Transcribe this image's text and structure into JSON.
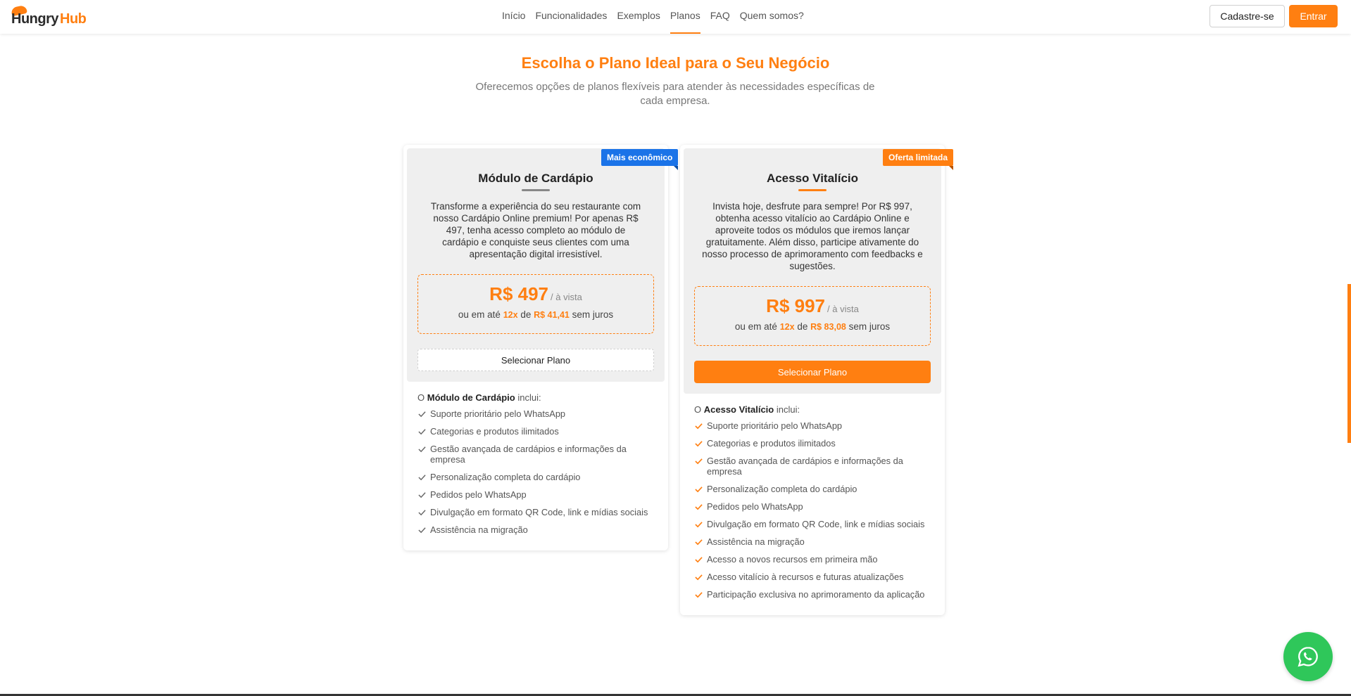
{
  "header": {
    "logo_part1": "Hungry",
    "logo_part2": "Hub",
    "nav": [
      "Início",
      "Funcionalidades",
      "Exemplos",
      "Planos",
      "FAQ",
      "Quem somos?"
    ],
    "signup_label": "Cadastre-se",
    "login_label": "Entrar"
  },
  "hero": {
    "title": "Escolha o Plano Ideal para o Seu Negócio",
    "subtitle": "Oferecemos opções de planos flexíveis para atender às necessidades específicas de cada empresa."
  },
  "plans": [
    {
      "badge": "Mais econômico",
      "name": "Módulo de Cardápio",
      "description": "Transforme a experiência do seu restaurante com nosso Cardápio Online premium! Por apenas R$ 497, tenha acesso completo ao módulo de cardápio e conquiste seus clientes com uma apresentação digital irresistível.",
      "price": "R$ 497",
      "price_suffix": "/ à vista",
      "install_prefix": "ou em até",
      "install_count": "12x",
      "install_mid": "de",
      "install_value": "R$ 41,41",
      "install_suffix": "sem juros",
      "button": "Selecionar Plano",
      "includes_prefix": "O",
      "includes_name": "Módulo de Cardápio",
      "includes_suffix": "inclui:",
      "features": [
        "Suporte prioritário pelo WhatsApp",
        "Categorias e produtos ilimitados",
        "Gestão avançada de cardápios e informações da empresa",
        "Personalização completa do cardápio",
        "Pedidos pelo WhatsApp",
        "Divulgação em formato QR Code, link e mídias sociais",
        "Assistência na migração"
      ]
    },
    {
      "badge": "Oferta limitada",
      "name": "Acesso Vitalício",
      "description": "Invista hoje, desfrute para sempre! Por R$ 997, obtenha acesso vitalício ao Cardápio Online e aproveite todos os módulos que iremos lançar gratuitamente. Além disso, participe ativamente do nosso processo de aprimoramento com feedbacks e sugestões.",
      "price": "R$ 997",
      "price_suffix": "/ à vista",
      "install_prefix": "ou em até",
      "install_count": "12x",
      "install_mid": "de",
      "install_value": "R$ 83,08",
      "install_suffix": "sem juros",
      "button": "Selecionar Plano",
      "includes_prefix": "O",
      "includes_name": "Acesso Vitalício",
      "includes_suffix": "inclui:",
      "features": [
        "Suporte prioritário pelo WhatsApp",
        "Categorias e produtos ilimitados",
        "Gestão avançada de cardápios e informações da empresa",
        "Personalização completa do cardápio",
        "Pedidos pelo WhatsApp",
        "Divulgação em formato QR Code, link e mídias sociais",
        "Assistência na migração",
        "Acesso a novos recursos em primeira mão",
        "Acesso vitalício à recursos e futuras atualizações",
        "Participação exclusiva no aprimoramento da aplicação"
      ]
    }
  ],
  "colors": {
    "accent": "#ff7f11",
    "badge_blue": "#1a73e8",
    "whatsapp": "#2fc75a"
  },
  "icons": {
    "whatsapp": "whatsapp-icon",
    "check": "check-icon"
  }
}
